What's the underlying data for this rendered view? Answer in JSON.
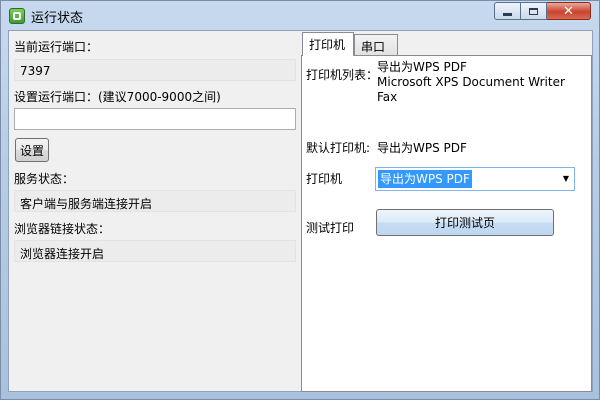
{
  "window": {
    "title": "运行状态",
    "close_glyph": "✕"
  },
  "left": {
    "current_port_label": "当前运行端口：",
    "current_port_value": "7397",
    "set_port_label": "设置运行端口：(建议7000-9000之间)",
    "set_port_value": "",
    "set_button": "设置",
    "service_status_label": "服务状态：",
    "service_status_value": "客户端与服务端连接开启",
    "browser_status_label": "浏览器链接状态：",
    "browser_status_value": "浏览器连接开启"
  },
  "tabs": [
    {
      "label": "打印机",
      "active": true
    },
    {
      "label": "串口",
      "active": false
    }
  ],
  "printer_tab": {
    "list_label": "打印机列表：",
    "printers": [
      "导出为WPS PDF",
      "Microsoft XPS Document Writer",
      "Fax"
    ],
    "default_label": "默认打印机:",
    "default_value": "导出为WPS PDF",
    "printer_label": "打印机",
    "printer_selected": "导出为WPS PDF",
    "test_label": "测试打印",
    "test_button": "打印测试页"
  },
  "icons": {
    "app": "app-icon",
    "minimize": "minimize-icon",
    "maximize": "maximize-icon",
    "close": "close-icon",
    "dropdown": "chevron-down-icon"
  },
  "colors": {
    "title_bar": "#b9cfe8",
    "selection": "#3399ff",
    "close_button": "#c9452f"
  }
}
